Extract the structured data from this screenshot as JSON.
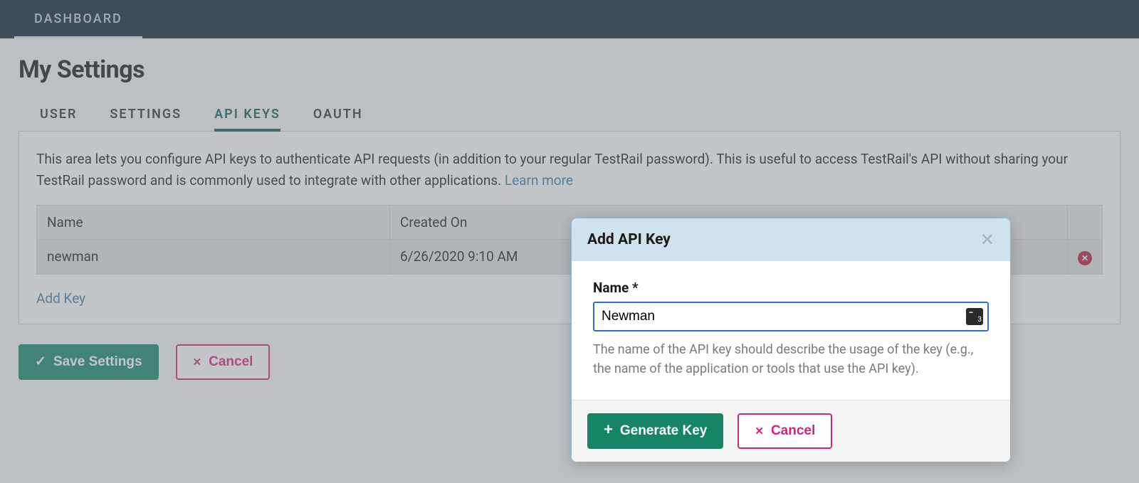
{
  "topbar": {
    "dashboard_label": "DASHBOARD"
  },
  "page": {
    "title": "My Settings"
  },
  "tabs": {
    "user": "USER",
    "settings": "SETTINGS",
    "api_keys": "API KEYS",
    "oauth": "OAUTH"
  },
  "panel": {
    "description": "This area lets you configure API keys to authenticate API requests (in addition to your regular TestRail password). This is useful to access TestRail's API without sharing your TestRail password and is commonly used to integrate with other applications. ",
    "learn_more": "Learn more"
  },
  "table": {
    "headers": {
      "name": "Name",
      "created_on": "Created On"
    },
    "rows": [
      {
        "name": "newman",
        "created_on": "6/26/2020 9:10 AM"
      }
    ]
  },
  "links": {
    "add_key": "Add Key"
  },
  "buttons": {
    "save_settings": "Save Settings",
    "cancel": "Cancel"
  },
  "modal": {
    "title": "Add API Key",
    "field_label": "Name *",
    "field_value": "Newman",
    "field_help": "The name of the API key should describe the usage of the key (e.g., the name of the application or tools that use the API key).",
    "generate_key": "Generate Key",
    "cancel": "Cancel"
  }
}
